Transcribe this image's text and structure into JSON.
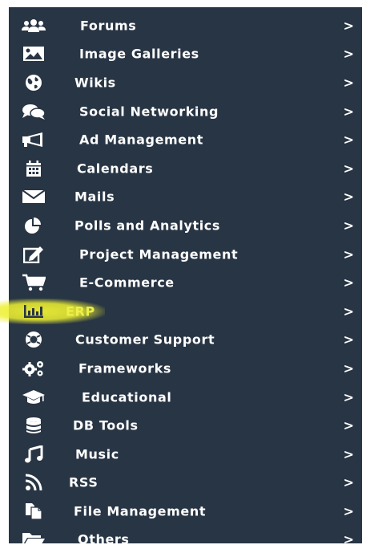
{
  "menu": {
    "chevron": ">",
    "highlight_color": "#eef04a",
    "background_color": "#283544",
    "items": [
      {
        "label": "Forums",
        "icon": "users-icon"
      },
      {
        "label": "Image Galleries",
        "icon": "image-icon"
      },
      {
        "label": "Wikis",
        "icon": "globe-icon"
      },
      {
        "label": "Social Networking",
        "icon": "comments-icon"
      },
      {
        "label": "Ad Management",
        "icon": "bullhorn-icon"
      },
      {
        "label": "Calendars",
        "icon": "calendar-icon"
      },
      {
        "label": "Mails",
        "icon": "envelope-icon"
      },
      {
        "label": "Polls and Analytics",
        "icon": "pie-chart-icon"
      },
      {
        "label": "Project Management",
        "icon": "edit-icon"
      },
      {
        "label": "E-Commerce",
        "icon": "shopping-cart-icon"
      },
      {
        "label": "ERP",
        "icon": "bar-chart-icon",
        "active": true
      },
      {
        "label": "Customer Support",
        "icon": "life-ring-icon"
      },
      {
        "label": "Frameworks",
        "icon": "cogs-icon"
      },
      {
        "label": "Educational",
        "icon": "graduation-cap-icon"
      },
      {
        "label": "DB Tools",
        "icon": "database-icon"
      },
      {
        "label": "Music",
        "icon": "music-icon"
      },
      {
        "label": "RSS",
        "icon": "rss-icon"
      },
      {
        "label": "File Management",
        "icon": "copy-files-icon"
      },
      {
        "label": "Others",
        "icon": "folder-open-icon"
      }
    ]
  }
}
